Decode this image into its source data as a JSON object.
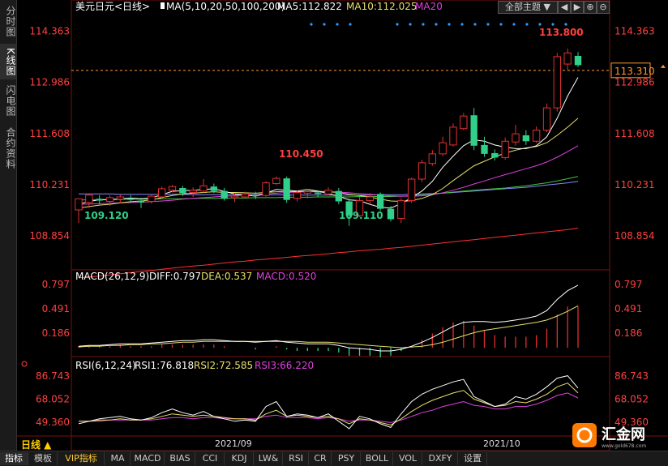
{
  "sidebar": {
    "items": [
      {
        "label": "分时图",
        "active": false
      },
      {
        "label": "K线图",
        "active": true
      },
      {
        "label": "闪电图",
        "active": false
      },
      {
        "label": "合约资料",
        "active": false
      }
    ]
  },
  "header": {
    "title": "美元日元<日线>",
    "ma_legend": "MA(5,10,20,50,100,200)",
    "ma5": "MA5:112.822",
    "ma10": "MA10:112.025",
    "ma20": "MA20",
    "theme_button": "全部主题",
    "theme_arrow": "▼"
  },
  "window_buttons": [
    "◀",
    "▶",
    "⊕",
    "⊖"
  ],
  "price_axis": {
    "ticks": [
      "114.363",
      "112.986",
      "111.608",
      "110.231",
      "108.854"
    ],
    "current_price": "113.310"
  },
  "annotations": {
    "high": "113.800",
    "mid_high": "110.450",
    "low1": "109.120",
    "low2": "109.110"
  },
  "macd_panel": {
    "legend": "MACD(26,12,9)",
    "diff": "DIFF:0.797",
    "dea": "DEA:0.537",
    "macd": "MACD:0.520",
    "ticks": [
      "0.797",
      "0.491",
      "0.186"
    ]
  },
  "rsi_panel": {
    "legend": "RSI(6,12,24)",
    "rsi1": "RSI1:76.818",
    "rsi2": "RSI2:72.585",
    "rsi3": "RSI3:66.220",
    "ticks": [
      "86.743",
      "68.052",
      "49.360"
    ]
  },
  "x_axis": {
    "labels": [
      "2021/09",
      "2021/10"
    ]
  },
  "period_label": "日线 ▲",
  "bottom_tabs": [
    "指标",
    "模板",
    "VIP指标",
    "MA",
    "MACD",
    "BIAS",
    "CCI",
    "KDJ",
    "LW&",
    "RSI",
    "CR",
    "PSY",
    "BOLL",
    "VOL",
    "DXFY",
    "设置"
  ],
  "logo": {
    "text": "汇金网",
    "url": "www.gold678.com"
  },
  "colors": {
    "up": "#e03030",
    "down": "#30d08a",
    "ma5": "#ffffff",
    "ma10": "#e8e06a",
    "ma20": "#e040e0",
    "ma50": "#3cc43c",
    "ma100": "#8888ff",
    "ma200": "#ff3030",
    "accent": "#ffcc00"
  },
  "chart_data": {
    "type": "candlestick",
    "price_range": [
      108.0,
      114.9
    ],
    "candles": [
      [
        109.55,
        109.85,
        109.2,
        109.86
      ],
      [
        109.75,
        109.95,
        109.6,
        109.98
      ],
      [
        109.85,
        109.8,
        109.7,
        109.95
      ],
      [
        109.78,
        109.88,
        109.66,
        109.94
      ],
      [
        109.84,
        109.9,
        109.72,
        109.96
      ],
      [
        109.86,
        109.82,
        109.74,
        109.95
      ],
      [
        109.8,
        109.75,
        109.6,
        109.88
      ],
      [
        109.78,
        109.92,
        109.72,
        109.98
      ],
      [
        109.9,
        110.12,
        109.84,
        110.18
      ],
      [
        110.08,
        110.18,
        110.02,
        110.22
      ],
      [
        110.14,
        110.0,
        109.92,
        110.2
      ],
      [
        110.02,
        110.08,
        109.9,
        110.16
      ],
      [
        110.06,
        110.2,
        110.0,
        110.38
      ],
      [
        110.18,
        110.06,
        110.0,
        110.26
      ],
      [
        110.06,
        109.85,
        109.8,
        110.14
      ],
      [
        109.88,
        109.92,
        109.76,
        110.0
      ],
      [
        109.9,
        109.98,
        109.86,
        110.04
      ],
      [
        109.96,
        109.92,
        109.84,
        110.04
      ],
      [
        109.94,
        110.28,
        109.9,
        110.32
      ],
      [
        110.26,
        110.4,
        110.22,
        110.45
      ],
      [
        110.4,
        109.82,
        109.74,
        110.45
      ],
      [
        109.86,
        110.02,
        109.78,
        110.08
      ],
      [
        110.0,
        110.04,
        109.86,
        110.12
      ],
      [
        110.02,
        109.98,
        109.9,
        110.08
      ],
      [
        109.98,
        110.08,
        109.94,
        110.16
      ],
      [
        110.06,
        109.78,
        109.7,
        110.14
      ],
      [
        109.78,
        109.4,
        109.12,
        109.86
      ],
      [
        109.4,
        109.8,
        109.36,
        109.9
      ],
      [
        109.8,
        109.9,
        109.7,
        110.0
      ],
      [
        109.98,
        109.58,
        109.52,
        110.02
      ],
      [
        109.58,
        109.3,
        109.24,
        109.66
      ],
      [
        109.32,
        109.8,
        109.2,
        109.86
      ],
      [
        109.8,
        110.38,
        109.74,
        110.42
      ],
      [
        110.38,
        110.82,
        110.3,
        110.9
      ],
      [
        110.8,
        111.06,
        110.74,
        111.16
      ],
      [
        111.06,
        111.36,
        111.0,
        111.52
      ],
      [
        111.3,
        111.78,
        111.26,
        111.88
      ],
      [
        111.74,
        112.08,
        111.7,
        112.16
      ],
      [
        112.1,
        111.28,
        111.16,
        112.3
      ],
      [
        111.3,
        111.06,
        110.98,
        111.52
      ],
      [
        111.08,
        110.96,
        110.88,
        111.18
      ],
      [
        110.96,
        111.4,
        110.9,
        111.5
      ],
      [
        111.38,
        111.6,
        111.28,
        111.84
      ],
      [
        111.56,
        111.4,
        111.3,
        111.7
      ],
      [
        111.4,
        111.7,
        111.36,
        111.8
      ],
      [
        111.7,
        112.3,
        111.64,
        112.42
      ],
      [
        112.3,
        113.68,
        112.2,
        113.78
      ],
      [
        113.48,
        113.78,
        113.3,
        113.9
      ],
      [
        113.7,
        113.45,
        113.4,
        113.8
      ]
    ],
    "ma5": [
      109.7,
      109.78,
      109.82,
      109.83,
      109.85,
      109.87,
      109.85,
      109.87,
      109.96,
      110.05,
      110.07,
      110.08,
      110.1,
      110.12,
      110.05,
      109.98,
      109.96,
      109.92,
      110.0,
      110.1,
      110.08,
      110.06,
      110.1,
      110.06,
      109.98,
      109.92,
      109.82,
      109.8,
      109.7,
      109.62,
      109.6,
      109.72,
      109.88,
      110.06,
      110.32,
      110.7,
      111.0,
      111.28,
      111.44,
      111.4,
      111.3,
      111.24,
      111.2,
      111.2,
      111.28,
      111.52,
      112.02,
      112.62,
      113.12
    ],
    "ma10": [
      109.6,
      109.64,
      109.68,
      109.7,
      109.74,
      109.77,
      109.79,
      109.82,
      109.88,
      109.94,
      109.98,
      110.0,
      110.02,
      110.04,
      110.02,
      110.02,
      110.01,
      110.0,
      110.02,
      110.04,
      110.05,
      110.04,
      110.05,
      110.05,
      110.04,
      110.02,
      109.97,
      109.94,
      109.9,
      109.84,
      109.79,
      109.78,
      109.8,
      109.86,
      109.96,
      110.13,
      110.34,
      110.54,
      110.74,
      110.86,
      110.98,
      111.08,
      111.16,
      111.22,
      111.26,
      111.36,
      111.56,
      111.78,
      112.02
    ],
    "ma20": [
      109.7,
      109.71,
      109.72,
      109.73,
      109.74,
      109.75,
      109.76,
      109.77,
      109.79,
      109.81,
      109.84,
      109.86,
      109.88,
      109.9,
      109.92,
      109.93,
      109.95,
      109.96,
      109.98,
      110.0,
      110.02,
      110.03,
      110.04,
      110.04,
      110.04,
      110.03,
      110.01,
      109.99,
      109.97,
      109.95,
      109.93,
      109.92,
      109.92,
      109.93,
      109.96,
      110.01,
      110.08,
      110.16,
      110.25,
      110.33,
      110.42,
      110.5,
      110.58,
      110.66,
      110.74,
      110.84,
      110.97,
      111.12,
      111.28
    ],
    "ma50": [
      109.82,
      109.82,
      109.83,
      109.83,
      109.83,
      109.84,
      109.84,
      109.84,
      109.85,
      109.85,
      109.85,
      109.86,
      109.86,
      109.86,
      109.87,
      109.87,
      109.87,
      109.88,
      109.88,
      109.88,
      109.89,
      109.89,
      109.89,
      109.9,
      109.9,
      109.9,
      109.9,
      109.91,
      109.91,
      109.91,
      109.91,
      109.92,
      109.93,
      109.95,
      109.97,
      110.0,
      110.03,
      110.06,
      110.08,
      110.1,
      110.12,
      110.14,
      110.17,
      110.2,
      110.24,
      110.28,
      110.33,
      110.39,
      110.45
    ],
    "ma100": [
      109.98,
      109.98,
      109.98,
      109.98,
      109.97,
      109.97,
      109.97,
      109.97,
      109.97,
      109.97,
      109.97,
      109.96,
      109.96,
      109.96,
      109.96,
      109.96,
      109.96,
      109.96,
      109.96,
      109.96,
      109.95,
      109.95,
      109.95,
      109.95,
      109.95,
      109.95,
      109.95,
      109.95,
      109.95,
      109.96,
      109.96,
      109.96,
      109.97,
      109.98,
      109.99,
      110.0,
      110.02,
      110.04,
      110.06,
      110.08,
      110.1,
      110.12,
      110.14,
      110.16,
      110.19,
      110.22,
      110.25,
      110.28,
      110.32
    ],
    "ma200": [
      107.72,
      107.74,
      107.77,
      107.8,
      107.83,
      107.86,
      107.89,
      107.92,
      107.95,
      107.98,
      108.01,
      108.04,
      108.06,
      108.09,
      108.12,
      108.15,
      108.17,
      108.2,
      108.22,
      108.25,
      108.27,
      108.3,
      108.32,
      108.34,
      108.37,
      108.4,
      108.42,
      108.45,
      108.47,
      108.49,
      108.52,
      108.54,
      108.57,
      108.6,
      108.63,
      108.66,
      108.69,
      108.72,
      108.75,
      108.78,
      108.81,
      108.84,
      108.87,
      108.9,
      108.93,
      108.96,
      108.99,
      109.02,
      109.06
    ],
    "macd": {
      "range": [
        -0.05,
        0.85
      ],
      "diff": [
        0.02,
        0.03,
        0.03,
        0.04,
        0.05,
        0.05,
        0.05,
        0.06,
        0.07,
        0.08,
        0.09,
        0.09,
        0.1,
        0.1,
        0.09,
        0.08,
        0.08,
        0.07,
        0.08,
        0.09,
        0.07,
        0.06,
        0.05,
        0.05,
        0.05,
        0.03,
        0.0,
        -0.01,
        -0.02,
        -0.04,
        -0.04,
        -0.02,
        0.02,
        0.07,
        0.13,
        0.2,
        0.27,
        0.32,
        0.33,
        0.33,
        0.32,
        0.33,
        0.35,
        0.37,
        0.4,
        0.47,
        0.61,
        0.72,
        0.79
      ],
      "dea": [
        0.01,
        0.02,
        0.02,
        0.03,
        0.03,
        0.04,
        0.04,
        0.05,
        0.05,
        0.06,
        0.07,
        0.07,
        0.08,
        0.08,
        0.08,
        0.08,
        0.08,
        0.08,
        0.08,
        0.08,
        0.08,
        0.08,
        0.07,
        0.07,
        0.07,
        0.06,
        0.05,
        0.04,
        0.03,
        0.02,
        0.01,
        0.0,
        0.01,
        0.02,
        0.04,
        0.07,
        0.11,
        0.15,
        0.19,
        0.22,
        0.24,
        0.26,
        0.28,
        0.3,
        0.32,
        0.35,
        0.4,
        0.46,
        0.53
      ],
      "hist": [
        0.02,
        0.02,
        0.02,
        0.02,
        0.04,
        0.02,
        0.02,
        0.02,
        0.04,
        0.04,
        0.04,
        0.04,
        0.04,
        0.04,
        0.02,
        0.0,
        0.0,
        -0.02,
        0.0,
        0.02,
        -0.02,
        -0.04,
        -0.04,
        -0.04,
        -0.04,
        -0.06,
        -0.1,
        -0.1,
        -0.1,
        -0.12,
        -0.1,
        -0.04,
        0.02,
        0.1,
        0.18,
        0.26,
        0.32,
        0.34,
        0.28,
        0.22,
        0.16,
        0.14,
        0.14,
        0.14,
        0.16,
        0.24,
        0.42,
        0.52,
        0.52
      ]
    },
    "rsi": {
      "range": [
        42,
        92
      ],
      "rsi1": [
        48,
        50,
        52,
        53,
        54,
        52,
        51,
        53,
        57,
        60,
        57,
        55,
        58,
        54,
        52,
        50,
        51,
        50,
        62,
        66,
        54,
        56,
        55,
        53,
        56,
        50,
        44,
        54,
        52,
        48,
        45,
        56,
        66,
        72,
        76,
        79,
        82,
        84,
        70,
        66,
        62,
        64,
        70,
        68,
        72,
        78,
        85,
        87,
        77
      ],
      "rsi2": [
        50,
        50,
        51,
        51,
        52,
        51,
        51,
        52,
        54,
        56,
        55,
        54,
        55,
        54,
        53,
        52,
        52,
        51,
        56,
        59,
        54,
        55,
        54,
        53,
        54,
        52,
        48,
        52,
        51,
        49,
        47,
        52,
        58,
        63,
        67,
        70,
        73,
        75,
        68,
        65,
        62,
        63,
        66,
        65,
        68,
        72,
        78,
        81,
        73
      ],
      "rsi3": [
        50,
        50,
        50,
        51,
        51,
        51,
        51,
        51,
        52,
        53,
        53,
        52,
        53,
        53,
        52,
        52,
        52,
        52,
        54,
        55,
        53,
        53,
        53,
        52,
        53,
        52,
        50,
        51,
        51,
        50,
        49,
        51,
        54,
        57,
        59,
        62,
        64,
        66,
        63,
        62,
        60,
        60,
        62,
        62,
        64,
        67,
        71,
        73,
        69
      ]
    }
  }
}
